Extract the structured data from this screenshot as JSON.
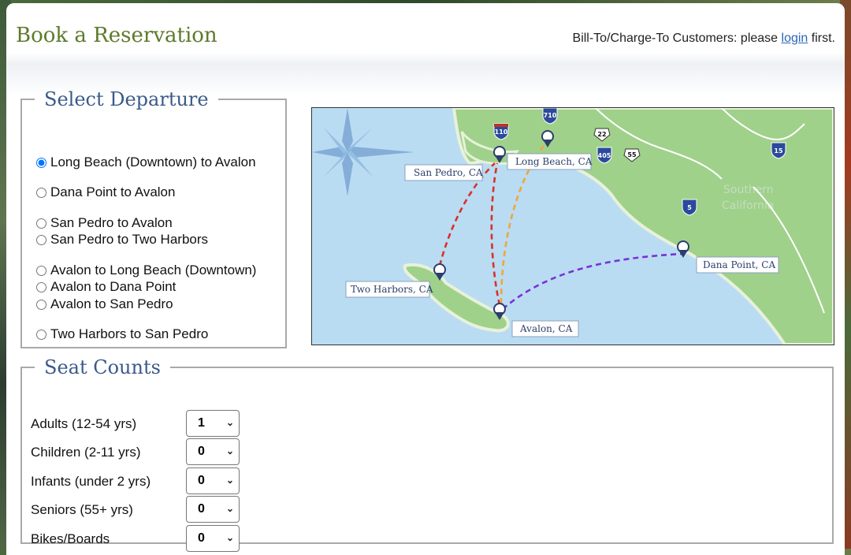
{
  "header": {
    "title": "Book a Reservation",
    "login_prefix": "Bill-To/Charge-To Customers: please ",
    "login_link": "login",
    "login_suffix": " first."
  },
  "departure": {
    "legend": "Select Departure",
    "selected_index": 0,
    "routes": [
      "Long Beach (Downtown) to Avalon",
      "Dana Point to Avalon",
      "San Pedro to Avalon",
      "San Pedro to Two Harbors",
      "Avalon to Long Beach (Downtown)",
      "Avalon to Dana Point",
      "Avalon to San Pedro",
      "Two Harbors to San Pedro"
    ]
  },
  "map": {
    "labels": {
      "san_pedro": "San Pedro, CA",
      "long_beach": "Long Beach, CA",
      "two_harbors": "Two Harbors, CA",
      "avalon": "Avalon, CA",
      "dana_point": "Dana Point, CA",
      "region_line1": "Southern",
      "region_line2": "California"
    },
    "shields": {
      "i110": "110",
      "i710": "710",
      "i405": "405",
      "i5": "5",
      "i15": "15",
      "r22": "22",
      "r55": "55"
    },
    "colors": {
      "water": "#b9dcf2",
      "land": "#9fd18a",
      "red_route": "#d9302b",
      "orange_route": "#f0a63a",
      "purple_route": "#7a32d6"
    }
  },
  "seats": {
    "legend": "Seat Counts",
    "rows": [
      {
        "label": "Adults (12-54 yrs)",
        "value": "1"
      },
      {
        "label": "Children (2-11 yrs)",
        "value": "0"
      },
      {
        "label": "Infants (under 2 yrs)",
        "value": "0"
      },
      {
        "label": "Seniors (55+ yrs)",
        "value": "0"
      },
      {
        "label": "Bikes/Boards",
        "value": "0"
      }
    ]
  }
}
